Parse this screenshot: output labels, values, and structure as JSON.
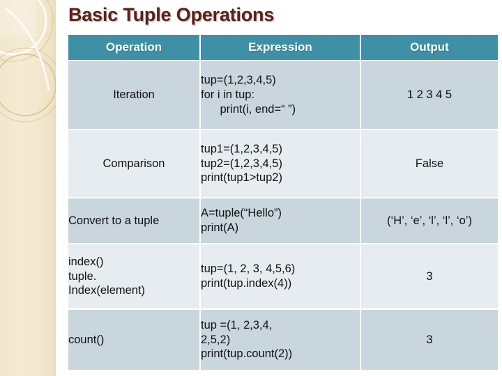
{
  "slide": {
    "title": "Basic Tuple Operations",
    "title_color": "#5c2018",
    "header_color": "#3e90a6",
    "row_shade_dark": "#c9d6dd",
    "row_shade_light": "#e7ecf0",
    "band_color": "#f1e3c6"
  },
  "table": {
    "columns": [
      {
        "label": "Operation"
      },
      {
        "label": "Expression"
      },
      {
        "label": "Output"
      }
    ],
    "rows": [
      {
        "operation": "Iteration",
        "expression": "tup=(1,2,3,4,5)\nfor i in tup:\n      print(i, end=“ ”)",
        "output": "1 2 3 4 5"
      },
      {
        "operation": "Comparison",
        "expression": "tup1=(1,2,3,4,5)\ntup2=(1,2,3,4,5)\nprint(tup1>tup2)",
        "output": "False"
      },
      {
        "operation": "Convert to a tuple",
        "expression": "A=tuple(“Hello”)\nprint(A)",
        "output": "(‘H’, ‘e’, ‘l’, ‘l’, ‘o’)"
      },
      {
        "operation": "index()\ntuple.\nIndex(element)",
        "expression": "tup=(1, 2, 3, 4,5,6)\nprint(tup.index(4))",
        "output": "3"
      },
      {
        "operation": "count()",
        "expression": "tup =(1, 2,3,4,\n2,5,2)\nprint(tup.count(2))",
        "output": "3"
      }
    ]
  },
  "decoration": {
    "band_name": "beige-arc-band"
  }
}
